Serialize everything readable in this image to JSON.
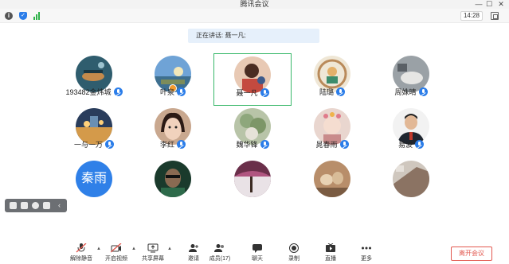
{
  "window": {
    "title": "腾讯会议",
    "controls": {
      "minimize": "—",
      "maximize": "☐",
      "close": "✕"
    }
  },
  "topbar": {
    "icons": [
      "info-icon",
      "shield-icon",
      "signal-icon"
    ],
    "time": "14:28"
  },
  "banner": {
    "speaking": "正在讲话: 聂一凡;"
  },
  "participants": [
    {
      "name": "193482金炜城",
      "muted": true
    },
    {
      "name": "叶泉",
      "muted": true,
      "host": true
    },
    {
      "name": "聂一凡",
      "muted": true,
      "active": true
    },
    {
      "name": "陆璐",
      "muted": true
    },
    {
      "name": "周姝晴",
      "muted": true
    },
    {
      "name": "一与一万",
      "muted": true
    },
    {
      "name": "李红",
      "muted": true
    },
    {
      "name": "魏华锋",
      "muted": true
    },
    {
      "name": "晁春雨",
      "muted": true
    },
    {
      "name": "易波",
      "muted": true
    },
    {
      "name": "",
      "text_avatar": "秦雨"
    },
    {
      "name": ""
    },
    {
      "name": ""
    },
    {
      "name": ""
    },
    {
      "name": ""
    }
  ],
  "toolbar": {
    "unmute": "解除静音",
    "start_video": "开启视频",
    "share_screen": "共享屏幕",
    "invite": "邀请",
    "members": "成员(17)",
    "chat": "聊天",
    "record": "录制",
    "live": "直播",
    "more": "更多",
    "leave": "离开会议"
  },
  "colors": {
    "accent": "#2b7de9",
    "active_border": "#39b86a",
    "leave": "#e2584f",
    "banner_bg": "#e6f0fb"
  }
}
